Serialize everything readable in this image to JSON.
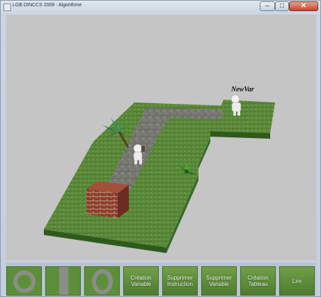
{
  "window": {
    "title": "LGB DINCCS 2009 : Algorithme",
    "controls": {
      "minimize": "–",
      "maximize": "□",
      "close": "✕"
    }
  },
  "scene": {
    "variable_label": "NewVar",
    "objects": [
      "path-tiles",
      "palm-tree-icon",
      "robot-figure-icon",
      "brick-block-icon",
      "fern-plant-icon",
      "platform-variable"
    ]
  },
  "toolbar": {
    "tiles": [
      {
        "type": "image",
        "icon": "ring-tile-icon"
      },
      {
        "type": "image",
        "icon": "straight-path-tile-icon"
      },
      {
        "type": "image",
        "icon": "loop-tile-icon"
      },
      {
        "type": "text",
        "lines": [
          "Création",
          "Variable"
        ]
      },
      {
        "type": "text",
        "lines": [
          "Supprimer",
          "Instruction"
        ]
      },
      {
        "type": "text",
        "lines": [
          "Supprimer",
          "Variable"
        ]
      },
      {
        "type": "text",
        "lines": [
          "Création",
          "Tableau"
        ]
      },
      {
        "type": "text",
        "lines": [
          "Lire"
        ]
      }
    ]
  },
  "colors": {
    "background": "#c5c5c5",
    "grass": "#5d8f3b",
    "path_stone": "#7d7d78",
    "brick": "#8a3b2a",
    "close_button": "#c3442b"
  }
}
